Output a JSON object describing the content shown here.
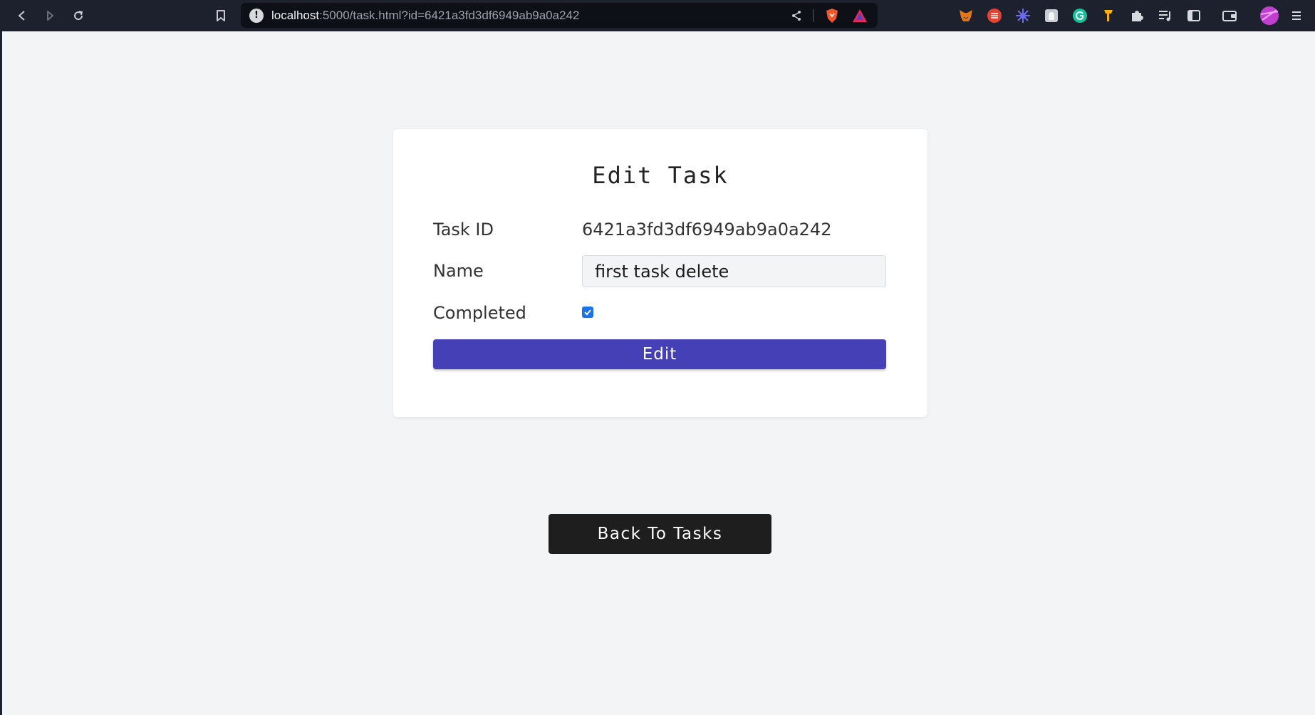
{
  "browser": {
    "url_host": "localhost",
    "url_path": ":5000/task.html?id=6421a3fd3df6949ab9a0a242",
    "extensions": [
      "metamask-icon",
      "todoist-icon",
      "sparkle-icon",
      "ghost-icon",
      "grammarly-icon",
      "key-icon",
      "puzzle-icon",
      "playlist-icon",
      "sidebar-icon",
      "wallet-icon",
      "profile-avatar",
      "menu-icon"
    ]
  },
  "card": {
    "title": "Edit Task",
    "task_id_label": "Task ID",
    "task_id_value": "6421a3fd3df6949ab9a0a242",
    "name_label": "Name",
    "name_value": "first task delete",
    "completed_label": "Completed",
    "completed": true,
    "edit_label": "Edit"
  },
  "back_label": "Back To Tasks",
  "colors": {
    "primary": "#4540b6",
    "dark_button": "#1e1e1e",
    "page_bg": "#f3f4f6",
    "checkbox": "#1a73e8"
  }
}
